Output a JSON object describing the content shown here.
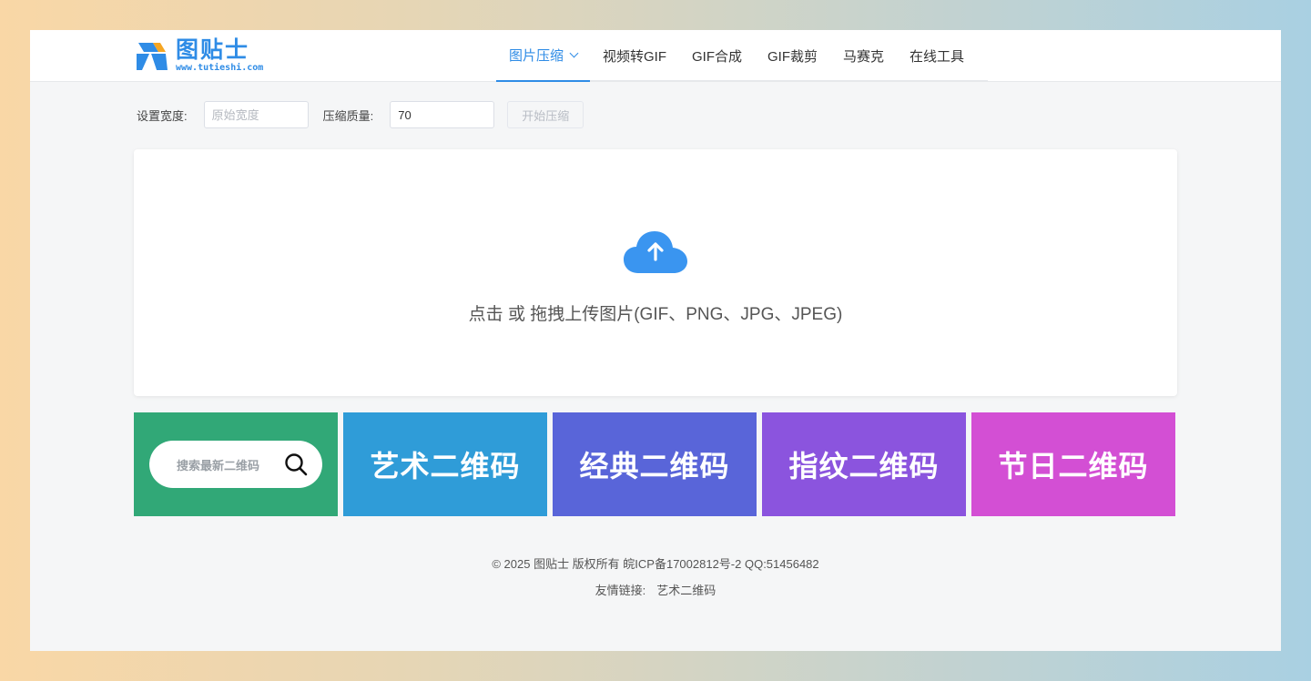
{
  "site": {
    "logo_name": "图贴士",
    "logo_url": "www.tutieshi.com"
  },
  "nav": {
    "items": [
      {
        "label": "图片压缩",
        "active": true
      },
      {
        "label": "视频转GIF"
      },
      {
        "label": "GIF合成"
      },
      {
        "label": "GIF裁剪"
      },
      {
        "label": "马赛克"
      },
      {
        "label": "在线工具"
      }
    ]
  },
  "settings": {
    "width_label": "设置宽度:",
    "width_placeholder": "原始宽度",
    "quality_label": "压缩质量:",
    "quality_value": "70",
    "start_button": "开始压缩"
  },
  "upload": {
    "text": "点击 或 拖拽上传图片(GIF、PNG、JPG、JPEG)"
  },
  "tiles": {
    "search_placeholder": "搜索最新二维码",
    "art": "艺术二维码",
    "classic": "经典二维码",
    "fingerprint": "指纹二维码",
    "holiday": "节日二维码"
  },
  "footer": {
    "copyright": "© 2025 图贴士 版权所有 皖ICP备17002812号-2 QQ:51456482",
    "links_label": "友情链接:",
    "link1": "艺术二维码"
  },
  "colors": {
    "accent": "#2f8ce6",
    "tile_search": "#31a877",
    "tile_art": "#2f9cd8",
    "tile_classic": "#5965d9",
    "tile_finger": "#8b54de",
    "tile_holiday": "#d34fd4"
  }
}
